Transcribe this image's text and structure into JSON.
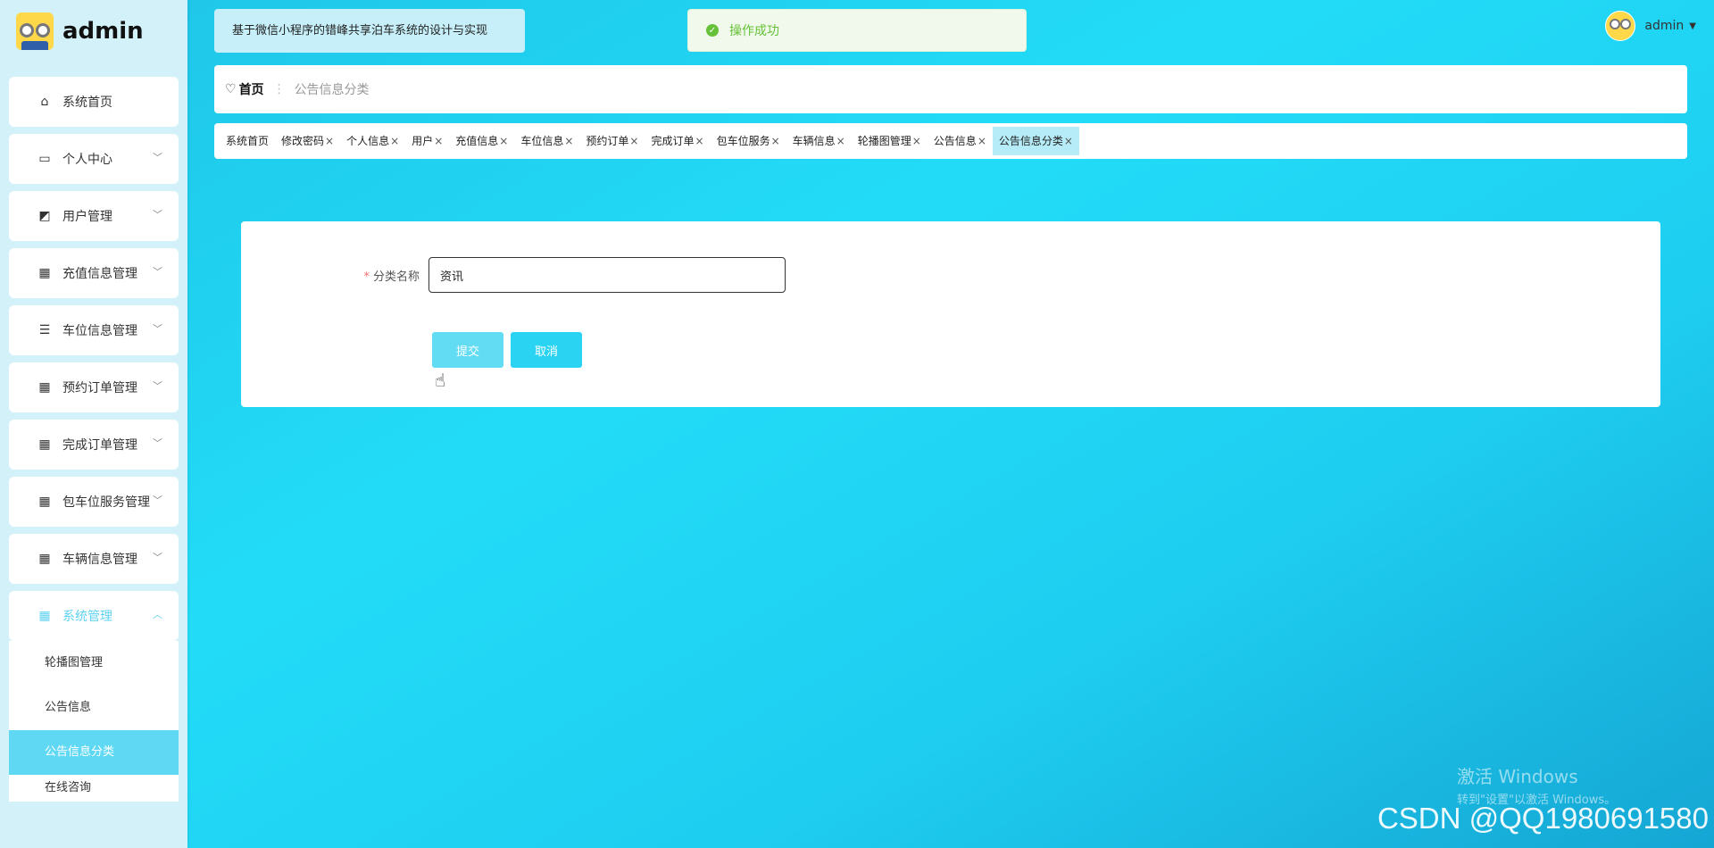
{
  "sidebar": {
    "brand_name": "admin",
    "menu": [
      {
        "label": "系统首页",
        "icon": "home-icon",
        "has_chevron": false
      },
      {
        "label": "个人中心",
        "icon": "card-icon",
        "has_chevron": true
      },
      {
        "label": "用户管理",
        "icon": "chart-icon",
        "has_chevron": true
      },
      {
        "label": "充值信息管理",
        "icon": "grid-icon",
        "has_chevron": true
      },
      {
        "label": "车位信息管理",
        "icon": "sliders-icon",
        "has_chevron": true
      },
      {
        "label": "预约订单管理",
        "icon": "grid-icon",
        "has_chevron": true
      },
      {
        "label": "完成订单管理",
        "icon": "grid-icon",
        "has_chevron": true
      },
      {
        "label": "包车位服务管理",
        "icon": "grid9-icon",
        "has_chevron": true
      },
      {
        "label": "车辆信息管理",
        "icon": "grid-icon",
        "has_chevron": true
      },
      {
        "label": "系统管理",
        "icon": "grid-icon",
        "has_chevron": true,
        "expanded": true
      }
    ],
    "submenu": [
      {
        "label": "轮播图管理"
      },
      {
        "label": "公告信息"
      },
      {
        "label": "公告信息分类",
        "active": true
      },
      {
        "label": "在线咨询"
      }
    ]
  },
  "header": {
    "system_title": "基于微信小程序的错峰共享泊车系统的设计与实现",
    "toast_message": "操作成功",
    "username": "admin"
  },
  "breadcrumb": {
    "home": "首页",
    "current": "公告信息分类"
  },
  "tags": [
    {
      "label": "系统首页",
      "closable": false
    },
    {
      "label": "修改密码",
      "closable": true
    },
    {
      "label": "个人信息",
      "closable": true
    },
    {
      "label": "用户",
      "closable": true
    },
    {
      "label": "充值信息",
      "closable": true
    },
    {
      "label": "车位信息",
      "closable": true
    },
    {
      "label": "预约订单",
      "closable": true
    },
    {
      "label": "完成订单",
      "closable": true
    },
    {
      "label": "包车位服务",
      "closable": true
    },
    {
      "label": "车辆信息",
      "closable": true
    },
    {
      "label": "轮播图管理",
      "closable": true
    },
    {
      "label": "公告信息",
      "closable": true
    },
    {
      "label": "公告信息分类",
      "closable": true,
      "active": true
    }
  ],
  "form": {
    "field_label": "分类名称",
    "field_value": "资讯",
    "submit_label": "提交",
    "cancel_label": "取消"
  },
  "watermark": {
    "activate_line1": "激活 Windows",
    "activate_line2": "转到\"设置\"以激活 Windows。",
    "csdn": "CSDN @QQ1980691580"
  },
  "colors": {
    "accent": "#2bd3f2",
    "active_submenu": "#5fd8f4",
    "toast_green": "#67c23a"
  }
}
